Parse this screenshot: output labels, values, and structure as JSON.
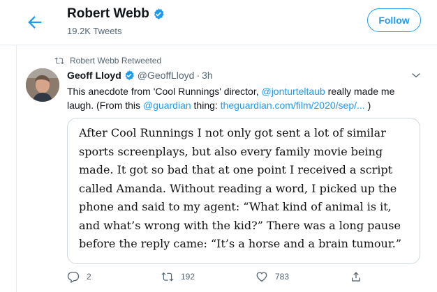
{
  "header": {
    "name": "Robert Webb",
    "tweet_count": "19.2K Tweets",
    "follow_label": "Follow"
  },
  "tweet": {
    "retweet_context": "Robert Webb Retweeted",
    "author_name": "Geoff Lloyd",
    "author_handle": "@GeoffLloyd",
    "separator": "·",
    "time": "3h",
    "text_part1": "This anecdote from 'Cool Runnings' director, ",
    "mention1": "@jonturteltaub",
    "text_part2": " really made me laugh. (From this ",
    "mention2": "@guardian",
    "text_part3": " thing: ",
    "link": "theguardian.com/film/2020/sep/...",
    "text_part4": " )",
    "quote_lines": [
      "After Cool Runnings I not only got sent a lot of similar",
      "sports screenplays, but also every family movie being",
      "made. It got so bad that at one point I received a script",
      "called Amanda. Without reading a word, I picked up the",
      "phone and said to my agent: “What kind of animal is it,",
      "and what’s wrong with the kid?” There was a long pause",
      "before the reply came: “It’s a horse and a brain tumour.”"
    ],
    "replies": "2",
    "retweets": "192",
    "likes": "783"
  },
  "icons": {
    "back": "back-arrow-icon",
    "verified": "verified-badge-icon",
    "retweet": "retweet-icon",
    "caret": "chevron-down-icon",
    "reply": "reply-icon",
    "like": "heart-icon",
    "share": "share-icon"
  },
  "colors": {
    "accent": "#1d9bf0",
    "secondary_text": "#536471",
    "border": "#cfd9de"
  }
}
